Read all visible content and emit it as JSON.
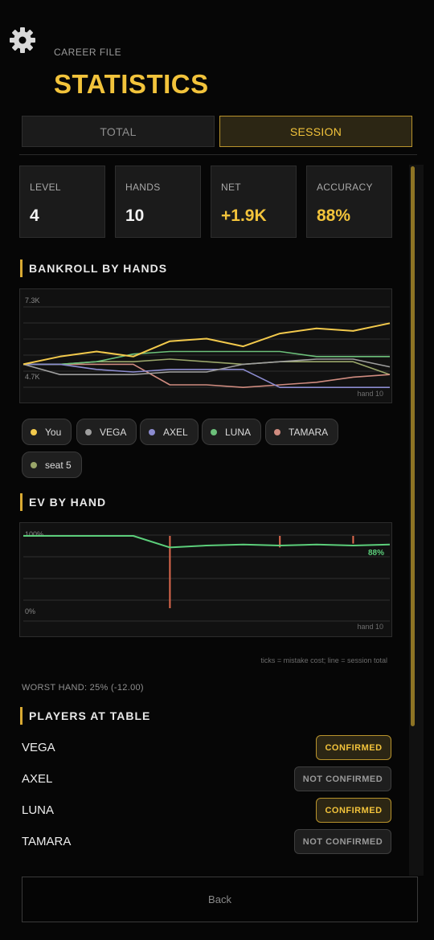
{
  "header": {
    "settings_icon": "gear-icon",
    "subtitle": "CAREER FILE",
    "title": "STATISTICS"
  },
  "tabs": [
    {
      "label": "TOTAL",
      "selected": false
    },
    {
      "label": "SESSION",
      "selected": true
    }
  ],
  "stats": [
    {
      "label": "LEVEL",
      "value": "4"
    },
    {
      "label": "HANDS",
      "value": "10"
    },
    {
      "label": "NET",
      "value": "+1.9K"
    },
    {
      "label": "ACCURACY",
      "value": "88%"
    }
  ],
  "bankroll": {
    "section_title": "BANKROLL BY HANDS",
    "y_top_label": "7.3K",
    "y_bottom_label": "4.7K",
    "x_label": "hand 10",
    "legend": [
      "You",
      "VEGA",
      "AXEL",
      "LUNA",
      "TAMARA",
      "seat 5"
    ]
  },
  "ev": {
    "section_title": "EV BY HAND",
    "y_top_label": "100%",
    "y_bottom_label": "0%",
    "x_label": "hand 10",
    "end_label": "88%",
    "note": "ticks = mistake cost; line = session total"
  },
  "worst_hand": "WORST HAND: 25% (-12.00)",
  "players": {
    "section_title": "PLAYERS AT TABLE",
    "list": [
      {
        "name": "VEGA",
        "status": "CONFIRMED"
      },
      {
        "name": "AXEL",
        "status": "NOT CONFIRMED"
      },
      {
        "name": "LUNA",
        "status": "CONFIRMED"
      },
      {
        "name": "TAMARA",
        "status": "NOT CONFIRMED"
      }
    ]
  },
  "back_label": "Back",
  "colors": {
    "accent": "#f2c33b",
    "you": "#f2c94c",
    "vega": "#9e9e9e",
    "axel": "#8c8cd0",
    "luna": "#6cc07a",
    "tamara": "#d08c80",
    "seat5": "#9aa66a",
    "ev_line": "#5ccf7b",
    "ev_tick": "#e06a4e"
  },
  "chart_data": [
    {
      "type": "line",
      "title": "BANKROLL BY HANDS",
      "x": [
        0,
        1,
        2,
        3,
        4,
        5,
        6,
        7,
        8,
        9,
        10
      ],
      "ylim": [
        4.7,
        7.3
      ],
      "ytick_labels": [
        "7.3K",
        "4.7K"
      ],
      "xlabel": "hand 10",
      "series": [
        {
          "name": "You",
          "values": [
            5.0,
            5.3,
            5.5,
            5.3,
            5.9,
            6.0,
            5.7,
            6.2,
            6.4,
            6.3,
            6.6
          ]
        },
        {
          "name": "VEGA",
          "values": [
            5.0,
            4.6,
            4.6,
            4.6,
            4.7,
            4.7,
            5.0,
            5.1,
            5.2,
            5.2,
            4.9
          ]
        },
        {
          "name": "AXEL",
          "values": [
            5.0,
            5.0,
            4.8,
            4.7,
            4.8,
            4.8,
            4.8,
            4.1,
            4.1,
            4.1,
            4.1
          ]
        },
        {
          "name": "LUNA",
          "values": [
            5.0,
            5.0,
            5.1,
            5.4,
            5.5,
            5.5,
            5.5,
            5.5,
            5.3,
            5.3,
            5.3
          ]
        },
        {
          "name": "TAMARA",
          "values": [
            5.0,
            5.0,
            5.0,
            5.0,
            4.2,
            4.2,
            4.1,
            4.2,
            4.3,
            4.5,
            4.6
          ]
        },
        {
          "name": "seat 5",
          "values": [
            5.0,
            5.0,
            5.1,
            5.1,
            5.2,
            5.1,
            5.0,
            5.1,
            5.1,
            5.1,
            4.6
          ]
        }
      ]
    },
    {
      "type": "line",
      "title": "EV BY HAND",
      "x": [
        0,
        1,
        2,
        3,
        4,
        5,
        6,
        7,
        8,
        9,
        10
      ],
      "ylim": [
        0,
        100
      ],
      "ytick_labels": [
        "100%",
        "0%"
      ],
      "xlabel": "hand 10",
      "series": [
        {
          "name": "session total",
          "values": [
            100,
            100,
            100,
            100,
            88,
            90,
            91,
            90,
            91,
            90,
            91
          ]
        }
      ],
      "mistake_ticks": [
        {
          "hand": 4,
          "from": 100,
          "to": 25
        },
        {
          "hand": 7,
          "from": 100,
          "to": 88
        },
        {
          "hand": 9,
          "from": 100,
          "to": 92
        }
      ],
      "end_label": "88%"
    }
  ]
}
